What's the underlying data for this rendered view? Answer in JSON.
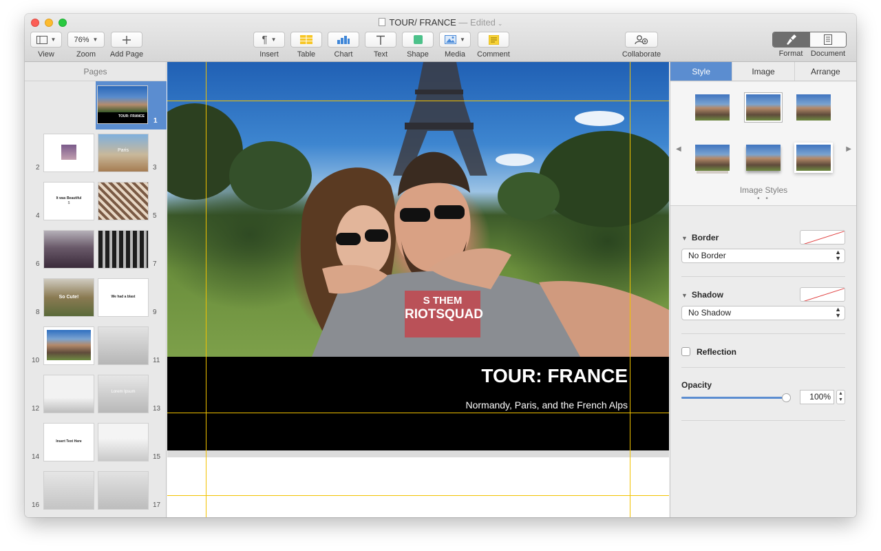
{
  "window": {
    "doc_title": "TOUR/ FRANCE",
    "separator": "—",
    "edited": "Edited",
    "caret": "⌄"
  },
  "toolbar": {
    "view": "View",
    "zoom": "Zoom",
    "zoom_value": "76%",
    "add_page": "Add Page",
    "insert": "Insert",
    "table": "Table",
    "chart": "Chart",
    "text": "Text",
    "shape": "Shape",
    "media": "Media",
    "comment": "Comment",
    "collaborate": "Collaborate",
    "format": "Format",
    "document": "Document"
  },
  "sidebar": {
    "title": "Pages",
    "pages": [
      {
        "num": "1",
        "caption": "TOUR: FRANCE",
        "sub": ""
      },
      {
        "num": "2",
        "caption": "",
        "sub": ""
      },
      {
        "num": "3",
        "caption": "Paris",
        "sub": ""
      },
      {
        "num": "4",
        "caption": "It was Beautiful",
        "sub": "$"
      },
      {
        "num": "5",
        "caption": "",
        "sub": ""
      },
      {
        "num": "6",
        "caption": "",
        "sub": ""
      },
      {
        "num": "7",
        "caption": "",
        "sub": ""
      },
      {
        "num": "8",
        "caption": "So Cute!",
        "sub": ""
      },
      {
        "num": "9",
        "caption": "We had a blast",
        "sub": ""
      },
      {
        "num": "10",
        "caption": "",
        "sub": ""
      },
      {
        "num": "11",
        "caption": "",
        "sub": ""
      },
      {
        "num": "12",
        "caption": "",
        "sub": ""
      },
      {
        "num": "13",
        "caption": "Lorem Ipsum",
        "sub": ""
      },
      {
        "num": "14",
        "caption": "Insert Text Here",
        "sub": ""
      },
      {
        "num": "15",
        "caption": "",
        "sub": ""
      },
      {
        "num": "16",
        "caption": "",
        "sub": ""
      },
      {
        "num": "17",
        "caption": "",
        "sub": ""
      }
    ]
  },
  "canvas": {
    "shirt_text_1": "S THEM",
    "shirt_text_2": "RIOTSQUAD",
    "headline": "TOUR: FRANCE",
    "subline": "Normandy, Paris, and the French Alps"
  },
  "inspector": {
    "tabs": [
      "Style",
      "Image",
      "Arrange"
    ],
    "active_tab": "Style",
    "image_styles_label": "Image Styles",
    "dots": "• •",
    "border_label": "Border",
    "border_value": "No Border",
    "shadow_label": "Shadow",
    "shadow_value": "No Shadow",
    "reflection_label": "Reflection",
    "reflection_checked": false,
    "opacity_label": "Opacity",
    "opacity_value": "100%",
    "opacity_level": 1.0
  },
  "colors": {
    "accent": "#5b8dd0",
    "guide": "#f2c200",
    "banner": "#000000"
  },
  "icons": {
    "view": "sidebar-layout-icon",
    "add_page": "plus-icon",
    "insert": "pilcrow-icon",
    "table": "table-grid-icon",
    "chart": "bar-chart-icon",
    "text": "text-t-icon",
    "shape": "square-shape-icon",
    "media": "photo-icon",
    "comment": "sticky-note-icon",
    "collaborate": "person-add-icon",
    "format": "paintbrush-icon",
    "document": "document-icon"
  }
}
